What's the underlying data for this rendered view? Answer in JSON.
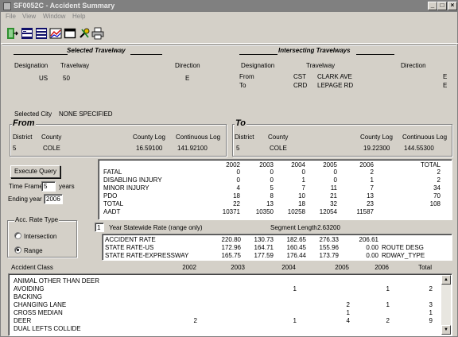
{
  "window": {
    "title": "SF0052C - Accident Summary",
    "menu": [
      "File",
      "View",
      "Window",
      "Help"
    ],
    "controls": {
      "minimize": "_",
      "maximize": "□",
      "close": "×"
    }
  },
  "toolbar": {
    "icons": [
      "exit-door-icon",
      "database-1-icon",
      "database-2-icon",
      "chart-icon",
      "window-icon",
      "tools-icon",
      "print-icon"
    ]
  },
  "selected": {
    "heading": "Selected Travelway",
    "col_designation": "Designation",
    "col_travelway": "Travelway",
    "col_direction": "Direction",
    "designation": "US",
    "travelway": "50",
    "direction": "E"
  },
  "intersecting": {
    "heading": "Intersecting Travelways",
    "col_designation": "Designation",
    "col_travelway": "Travelway",
    "col_direction": "Direction",
    "rows": [
      {
        "label": "From",
        "code": "CST",
        "name": "CLARK AVE",
        "direction": "E"
      },
      {
        "label": "To",
        "code": "CRD",
        "name": "LEPAGE RD",
        "direction": "E"
      }
    ]
  },
  "selected_city": {
    "label": "Selected City",
    "value": "NONE SPECIFIED"
  },
  "from": {
    "title": "From",
    "col_district": "District",
    "col_county": "County",
    "col_county_log": "County Log",
    "col_continuous_log": "Continuous Log",
    "district": "5",
    "county": "COLE",
    "county_log": "16.59100",
    "continuous_log": "141.92100"
  },
  "to": {
    "title": "To",
    "col_district": "District",
    "col_county": "County",
    "col_county_log": "County Log",
    "col_continuous_log": "Continuous Log",
    "district": "5",
    "county": "COLE",
    "county_log": "19.22300",
    "continuous_log": "144.55300"
  },
  "query": {
    "execute_label": "Execute Query",
    "time_frame_label": "Time Frame",
    "time_frame_value": "5",
    "years_label": "years",
    "ending_year_label": "Ending year",
    "ending_year_value": "2006"
  },
  "rate_type": {
    "title": "Acc. Rate Type",
    "options": [
      {
        "label": "Intersection",
        "selected": false
      },
      {
        "label": "Range",
        "selected": true
      }
    ]
  },
  "summary": {
    "columns": [
      "2002",
      "2003",
      "2004",
      "2005",
      "2006",
      "TOTAL"
    ],
    "rows": [
      {
        "label": "FATAL",
        "values": [
          "0",
          "0",
          "0",
          "0",
          "2",
          "2"
        ]
      },
      {
        "label": "DISABLING INJURY",
        "values": [
          "0",
          "0",
          "1",
          "0",
          "1",
          "2"
        ]
      },
      {
        "label": "MINOR INJURY",
        "values": [
          "4",
          "5",
          "7",
          "11",
          "7",
          "34"
        ]
      },
      {
        "label": "PDO",
        "values": [
          "18",
          "8",
          "10",
          "21",
          "13",
          "70"
        ]
      },
      {
        "label": "TOTAL",
        "values": [
          "22",
          "13",
          "18",
          "32",
          "23",
          "108"
        ]
      },
      {
        "label": "AADT",
        "values": [
          "10371",
          "10350",
          "10258",
          "12054",
          "11587",
          ""
        ]
      }
    ]
  },
  "rate_options": {
    "year_value": "1",
    "year_label": "Year Statewide Rate (range only)",
    "segment_length_label": "Segment Length",
    "segment_length_value": "2.63200"
  },
  "rates": {
    "rows": [
      {
        "label": "ACCIDENT RATE",
        "values": [
          "220.80",
          "130.73",
          "182.65",
          "276.33",
          "206.61"
        ],
        "note": ""
      },
      {
        "label": "STATE RATE-US",
        "values": [
          "172.96",
          "164.71",
          "160.45",
          "155.96",
          "0.00"
        ],
        "note": "ROUTE DESG"
      },
      {
        "label": "STATE RATE-EXPRESSWAY",
        "values": [
          "165.75",
          "177.59",
          "176.44",
          "173.79",
          "0.00"
        ],
        "note": "RDWAY_TYPE"
      }
    ]
  },
  "accident_class": {
    "label": "Accident Class",
    "columns": [
      "2002",
      "2003",
      "2004",
      "2005",
      "2006",
      "Total"
    ],
    "rows": [
      {
        "label": "ANIMAL OTHER THAN DEER",
        "values": [
          "",
          "",
          "",
          "",
          "",
          ""
        ]
      },
      {
        "label": "AVOIDING",
        "values": [
          "",
          "",
          "1",
          "",
          "1",
          "2"
        ]
      },
      {
        "label": "BACKING",
        "values": [
          "",
          "",
          "",
          "",
          "",
          ""
        ]
      },
      {
        "label": "CHANGING LANE",
        "values": [
          "",
          "",
          "",
          "2",
          "1",
          "3"
        ]
      },
      {
        "label": "CROSS MEDIAN",
        "values": [
          "",
          "",
          "",
          "1",
          "",
          "1"
        ]
      },
      {
        "label": "DEER",
        "values": [
          "2",
          "",
          "1",
          "4",
          "2",
          "9"
        ]
      },
      {
        "label": "DUAL LEFTS COLLIDE",
        "values": [
          "",
          "",
          "",
          "",
          "",
          ""
        ]
      }
    ]
  }
}
